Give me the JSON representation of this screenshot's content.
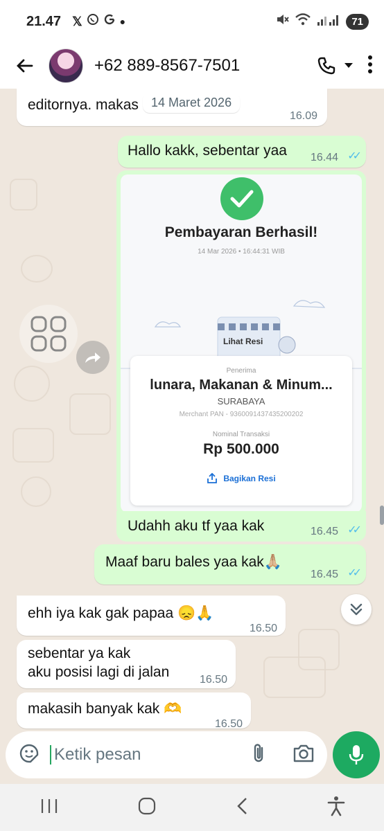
{
  "status_bar": {
    "time": "21.47",
    "notif_icons": [
      "x-icon",
      "whatsapp-icon",
      "google-icon",
      "dot"
    ],
    "battery": "71"
  },
  "header": {
    "contact": "+62 889-8567-7501"
  },
  "chat": {
    "date_chip": "14 Maret 2026",
    "messages": [
      {
        "dir": "in",
        "text": "editornya. makas",
        "time": "16.09"
      },
      {
        "dir": "out",
        "text": "Hallo kakk, sebentar yaa",
        "time": "16.44"
      },
      {
        "dir": "out",
        "type": "image",
        "caption": "Udahh aku tf yaa kak",
        "time": "16.45"
      },
      {
        "dir": "out",
        "text": "Maaf baru bales yaa kak🙏🏼",
        "time": "16.45"
      },
      {
        "dir": "in",
        "text": "ehh iya kak gak papaa 😞🙏",
        "time": "16.50"
      },
      {
        "dir": "in",
        "text_line1": "sebentar ya kak",
        "text_line2": "aku posisi lagi di jalan",
        "time": "16.50"
      },
      {
        "dir": "in",
        "text": "makasih banyak kak 🫶",
        "time": "16.50"
      }
    ]
  },
  "receipt": {
    "title": "Pembayaran Berhasil!",
    "datetime": "14 Mar 2026 • 16:44:31 WIB",
    "view_label": "Lihat Resi",
    "recipient_label": "Penerima",
    "merchant": "lunara, Makanan & Minum...",
    "city": "SURABAYA",
    "pan": "Merchant PAN - 9360091437435200202",
    "amount_label": "Nominal Transaksi",
    "amount": "Rp 500.000",
    "share": "Bagikan Resi"
  },
  "input": {
    "placeholder": "Ketik pesan"
  },
  "colors": {
    "incoming": "#ffffff",
    "outgoing": "#d9fdd3",
    "accent": "#1daa61",
    "read_ticks": "#53bdeb",
    "chat_bg": "#efe7de"
  }
}
